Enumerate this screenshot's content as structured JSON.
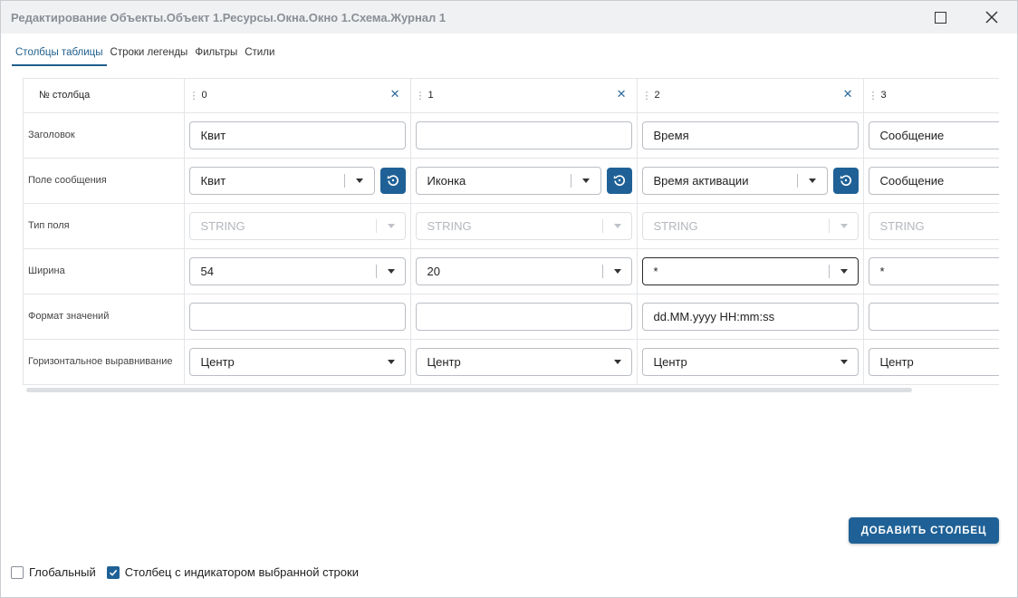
{
  "window": {
    "title": "Редактирование Объекты.Объект 1.Ресурсы.Окна.Окно 1.Схема.Журнал 1"
  },
  "tabs": [
    {
      "label": "Столбцы таблицы",
      "active": true
    },
    {
      "label": "Строки легенды",
      "active": false
    },
    {
      "label": "Фильтры",
      "active": false
    },
    {
      "label": "Стили",
      "active": false
    }
  ],
  "grid": {
    "header_label": "№ столбца",
    "row_labels": {
      "title": "Заголовок",
      "message_field": "Поле сообщения",
      "field_type": "Тип поля",
      "width": "Ширина",
      "value_format": "Формат значений",
      "h_align": "Горизонтальное выравнивание"
    },
    "columns": [
      {
        "number": "0",
        "title": "Квит",
        "message_field": "Квит",
        "field_type": "STRING",
        "width": "54",
        "value_format": "",
        "h_align": "Центр"
      },
      {
        "number": "1",
        "title": "",
        "message_field": "Иконка",
        "field_type": "STRING",
        "width": "20",
        "value_format": "",
        "h_align": "Центр"
      },
      {
        "number": "2",
        "title": "Время",
        "message_field": "Время активации",
        "field_type": "STRING",
        "width": "*",
        "value_format": "dd.MM.yyyy HH:mm:ss",
        "h_align": "Центр"
      },
      {
        "number": "3",
        "title": "Сообщение",
        "message_field": "Сообщение",
        "field_type": "STRING",
        "width": "*",
        "value_format": "",
        "h_align": "Центр"
      }
    ]
  },
  "actions": {
    "add_column": "ДОБАВИТЬ СТОЛБЕЦ"
  },
  "options": {
    "global_label": "Глобальный",
    "global_checked": false,
    "indicator_label": "Столбец с индикатором выбранной строки",
    "indicator_checked": true
  },
  "colors": {
    "accent": "#1f6196",
    "tab_active": "#1f5f8d",
    "title_text": "#8a8f96"
  },
  "icons": [
    "maximize-icon",
    "close-icon",
    "drag-handle-icon",
    "remove-column-icon",
    "reset-icon",
    "dropdown-arrow-icon",
    "checkmark-icon"
  ]
}
